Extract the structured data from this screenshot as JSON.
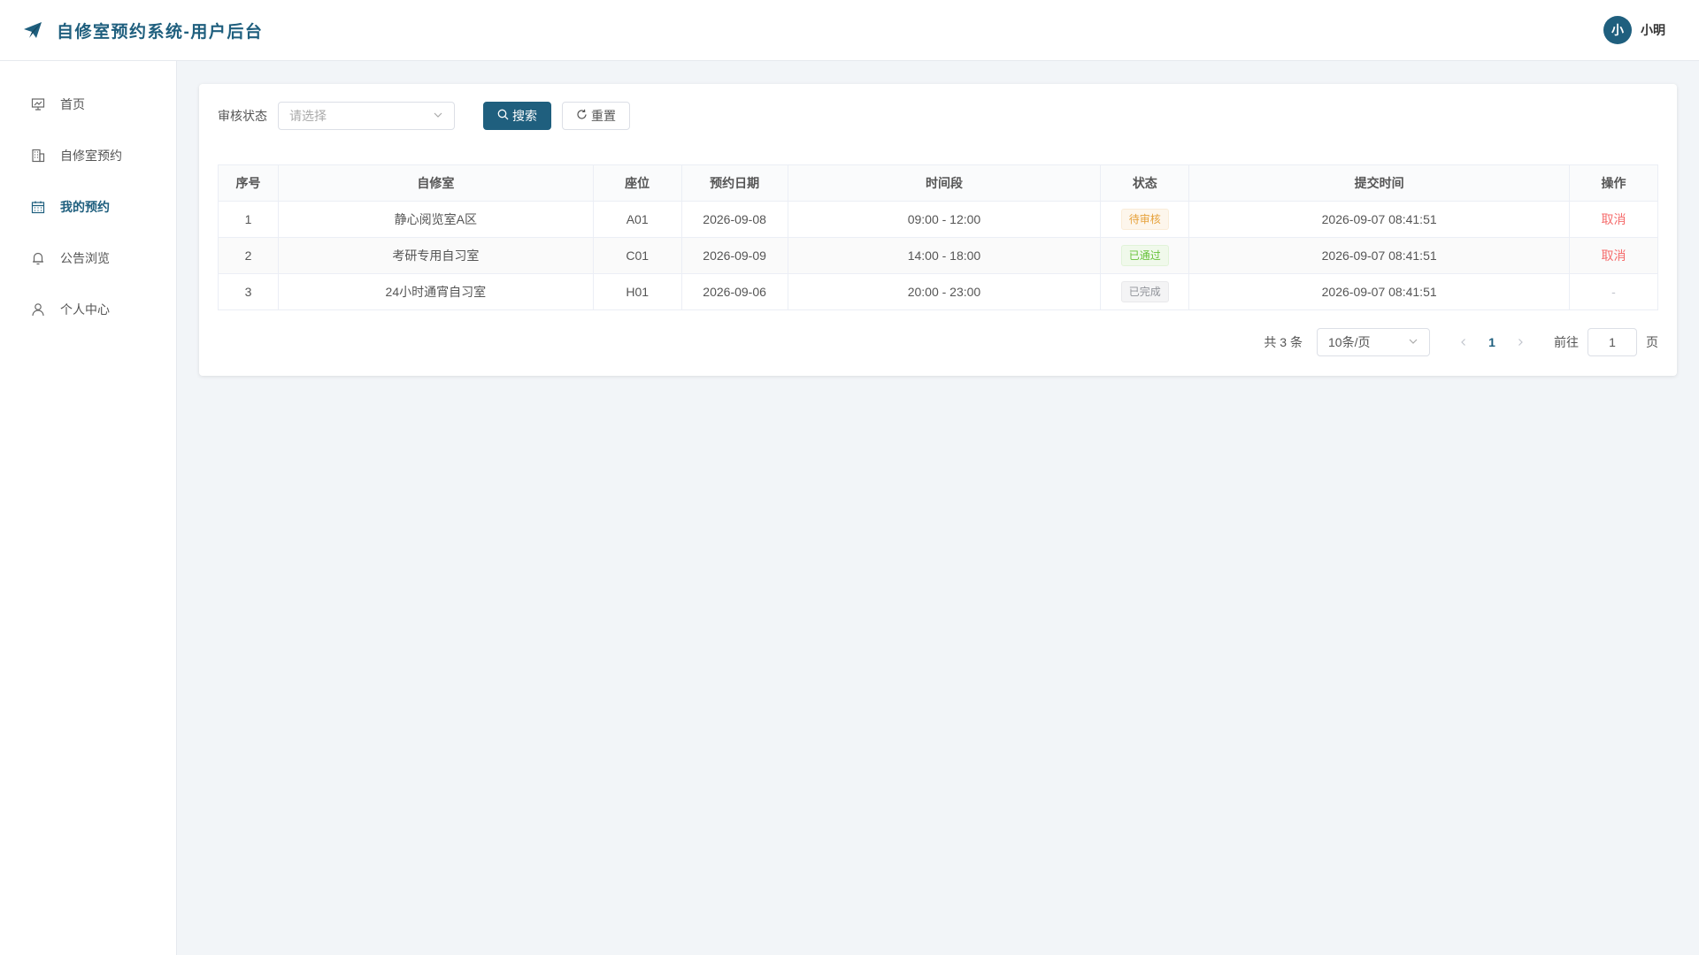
{
  "header": {
    "title": "自修室预约系统-用户后台",
    "avatar_text": "小",
    "username": "小明"
  },
  "sidebar": {
    "items": [
      {
        "label": "首页",
        "icon": "presentation-icon",
        "active": false
      },
      {
        "label": "自修室预约",
        "icon": "building-icon",
        "active": false
      },
      {
        "label": "我的预约",
        "icon": "calendar-icon",
        "active": true
      },
      {
        "label": "公告浏览",
        "icon": "bell-icon",
        "active": false
      },
      {
        "label": "个人中心",
        "icon": "user-icon",
        "active": false
      }
    ]
  },
  "filter": {
    "label": "审核状态",
    "placeholder": "请选择",
    "search_label": "搜索",
    "reset_label": "重置"
  },
  "table": {
    "columns": [
      "序号",
      "自修室",
      "座位",
      "预约日期",
      "时间段",
      "状态",
      "提交时间",
      "操作"
    ],
    "rows": [
      {
        "index": "1",
        "room": "静心阅览室A区",
        "seat": "A01",
        "date": "2026-09-08",
        "slot": "09:00 - 12:00",
        "status": "待审核",
        "submitted": "2026-09-07 08:41:51",
        "action": "取消"
      },
      {
        "index": "2",
        "room": "考研专用自习室",
        "seat": "C01",
        "date": "2026-09-09",
        "slot": "14:00 - 18:00",
        "status": "已通过",
        "submitted": "2026-09-07 08:41:51",
        "action": "取消"
      },
      {
        "index": "3",
        "room": "24小时通宵自习室",
        "seat": "H01",
        "date": "2026-09-06",
        "slot": "20:00 - 23:00",
        "status": "已完成",
        "submitted": "2026-09-07 08:41:51",
        "action": "-"
      }
    ]
  },
  "pagination": {
    "total_text": "共 3 条",
    "page_size": "10条/页",
    "current_page": "1",
    "goto_prefix": "前往",
    "goto_value": "1",
    "goto_suffix": "页"
  },
  "colors": {
    "primary": "#1f5f7e",
    "danger": "#f56c6c",
    "warning": "#e6a23c",
    "success": "#67c23a",
    "info": "#909399"
  }
}
